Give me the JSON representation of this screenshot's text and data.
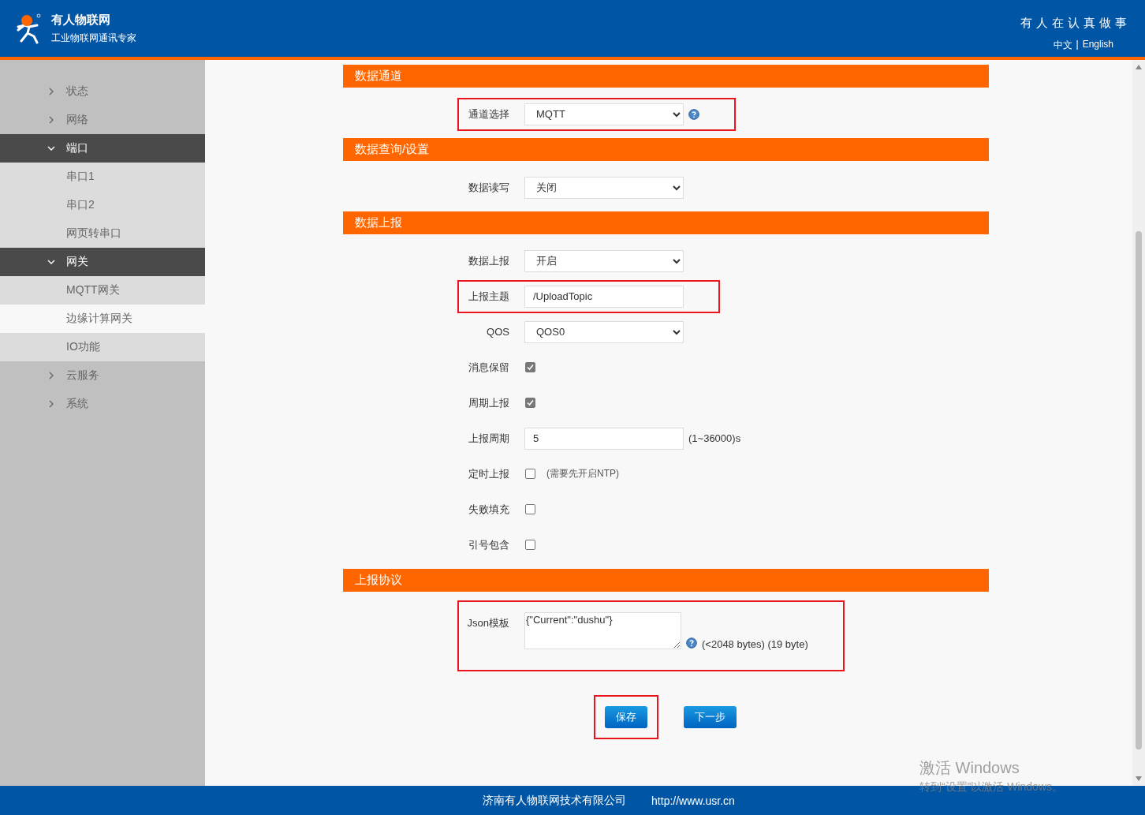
{
  "header": {
    "brand": "有人物联网",
    "tagline": "工业物联网通讯专家",
    "slogan": "有人在认真做事",
    "languages": [
      {
        "label": "中文"
      },
      {
        "label": "English"
      }
    ],
    "separator": "|"
  },
  "sidebar": {
    "items": [
      {
        "label": "状态",
        "expanded": false
      },
      {
        "label": "网络",
        "expanded": false
      },
      {
        "label": "端口",
        "expanded": true,
        "children": [
          {
            "label": "串口1",
            "selected": false
          },
          {
            "label": "串口2",
            "selected": false
          },
          {
            "label": "网页转串口",
            "selected": false
          }
        ]
      },
      {
        "label": "网关",
        "expanded": true,
        "children": [
          {
            "label": "MQTT网关",
            "selected": false
          },
          {
            "label": "边缘计算网关",
            "selected": true
          },
          {
            "label": "IO功能",
            "selected": false
          }
        ]
      },
      {
        "label": "云服务",
        "expanded": false
      },
      {
        "label": "系统",
        "expanded": false
      }
    ]
  },
  "sections": [
    {
      "title": "数据通道",
      "rows": [
        {
          "kind": "select",
          "label": "通道选择",
          "value": "MQTT",
          "help": true,
          "highlighted": true
        }
      ]
    },
    {
      "title": "数据查询/设置",
      "rows": [
        {
          "kind": "select",
          "label": "数据读写",
          "value": "关闭",
          "highlighted": false
        }
      ]
    },
    {
      "title": "数据上报",
      "rows": [
        {
          "kind": "select",
          "label": "数据上报",
          "value": "开启",
          "highlighted": false
        },
        {
          "kind": "text",
          "label": "上报主题",
          "value": "/UploadTopic",
          "highlighted": true
        },
        {
          "kind": "select",
          "label": "QOS",
          "value": "QOS0",
          "highlighted": false
        },
        {
          "kind": "checkbox",
          "label": "消息保留",
          "checked": true,
          "highlighted": false
        },
        {
          "kind": "checkbox",
          "label": "周期上报",
          "checked": true,
          "highlighted": false
        },
        {
          "kind": "text",
          "label": "上报周期",
          "value": "5",
          "suffix": "(1~36000)s",
          "highlighted": false
        },
        {
          "kind": "checkbox",
          "label": "定时上报",
          "checked": false,
          "suffix": "(需要先开启NTP)",
          "highlighted": false
        },
        {
          "kind": "checkbox",
          "label": "失败填充",
          "checked": false,
          "highlighted": false
        },
        {
          "kind": "checkbox",
          "label": "引号包含",
          "checked": false,
          "highlighted": false
        }
      ]
    },
    {
      "title": "上报协议",
      "rows": [
        {
          "kind": "textarea",
          "label": "Json模板",
          "value": "{\"Current\":\"dushu\"}",
          "help": true,
          "suffix": "(<2048 bytes) (19 byte)",
          "highlighted": true
        }
      ]
    }
  ],
  "buttons": [
    {
      "label": "保存",
      "highlighted": true
    },
    {
      "label": "下一步",
      "highlighted": false
    }
  ],
  "footer": {
    "company": "济南有人物联网技术有限公司",
    "url": "http://www.usr.cn"
  },
  "os_overlay": {
    "title": "激活 Windows",
    "subtitle": "转到“设置”以激活 Windows。"
  }
}
